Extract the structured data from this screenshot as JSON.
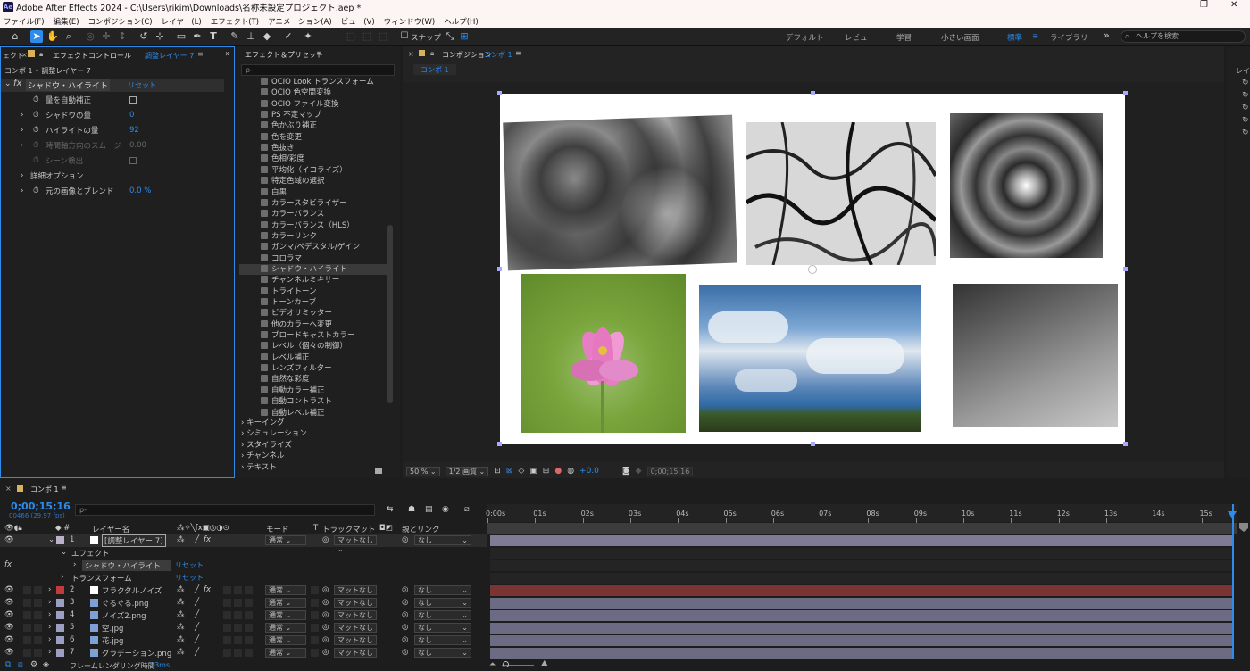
{
  "app": {
    "title": "Adobe After Effects 2024 - C:\\Users\\rikim\\Downloads\\名称未設定プロジェクト.aep *",
    "logo": "Ae",
    "window_buttons": [
      "─",
      "❐",
      "✕"
    ]
  },
  "menu": [
    "ファイル(F)",
    "編集(E)",
    "コンポジション(C)",
    "レイヤー(L)",
    "エフェクト(T)",
    "アニメーション(A)",
    "ビュー(V)",
    "ウィンドウ(W)",
    "ヘルプ(H)"
  ],
  "toolbar": {
    "snap_label": "スナップ",
    "workspaces": [
      "デフォルト",
      "レビュー",
      "学習",
      "小さい画面",
      "標準",
      "ライブラリ"
    ],
    "active_workspace": "標準",
    "more": "»",
    "help_placeholder": "ヘルプを検索"
  },
  "effect_controls": {
    "tab_prev": "ェクト",
    "tab_label": "エフェクトコントロール",
    "tab_layer": "調整レイヤー 7",
    "breadcrumb": "コンポ 1 • 調整レイヤー 7",
    "fx": "fx",
    "effect_name": "シャドウ・ハイライト",
    "reset": "リセット",
    "props": [
      {
        "label": "量を自動補正",
        "value": ""
      },
      {
        "label": "シャドウの量",
        "value": "0"
      },
      {
        "label": "ハイライトの量",
        "value": "92"
      },
      {
        "label": "時間軸方向のスムージ",
        "value": "0.00"
      },
      {
        "label": "シーン検出",
        "value": ""
      },
      {
        "label": "詳細オプション",
        "value": ""
      },
      {
        "label": "元の画像とブレンド",
        "value": "0.0 %"
      }
    ]
  },
  "effects_presets": {
    "tab_label": "エフェクト＆プリセット",
    "search_placeholder": "ρ-",
    "items": [
      "OCIO Look トランスフォーム",
      "OCIO 色空間変換",
      "OCIO ファイル変換",
      "PS 不定マップ",
      "色かぶり補正",
      "色を変更",
      "色抜き",
      "色相/彩度",
      "平均化（イコライズ）",
      "特定色域の選択",
      "白黒",
      "カラースタビライザー",
      "カラーバランス",
      "カラーバランス（HLS）",
      "カラーリンク",
      "ガンマ/ペデスタル/ゲイン",
      "コロラマ",
      "シャドウ・ハイライト",
      "チャンネルミキサー",
      "トライトーン",
      "トーンカーブ",
      "ビデオリミッター",
      "他のカラーへ変更",
      "ブロードキャストカラー",
      "レベル（個々の制御）",
      "レベル補正",
      "レンズフィルター",
      "自然な彩度",
      "自動カラー補正",
      "自動コントラスト",
      "自動レベル補正"
    ],
    "selected": "シャドウ・ハイライト",
    "categories": [
      "キーイング",
      "シミュレーション",
      "スタイライズ",
      "チャンネル",
      "テキスト"
    ]
  },
  "composition": {
    "tab_label": "コンポジション",
    "tab_comp": "コンポ 1",
    "sub_tab": "コンポ 1",
    "zoom": "50 %",
    "resolution": "1/2 画質",
    "exposure": "+0.0",
    "timecode": "0;00;15;16"
  },
  "timeline": {
    "tab_label": "コンポ 1",
    "timecode": "0;00;15;16",
    "frame_info": "00466 (29.97 fps)",
    "search_placeholder": "ρ-",
    "headers": {
      "layer_name": "レイヤー名",
      "mode": "モード",
      "t": "T",
      "track_matte": "トラックマット",
      "parent": "親とリンク"
    },
    "ruler": [
      "0:00s",
      "01s",
      "02s",
      "03s",
      "04s",
      "05s",
      "06s",
      "07s",
      "08s",
      "09s",
      "10s",
      "11s",
      "12s",
      "13s",
      "14s",
      "15s"
    ],
    "layers": [
      {
        "num": "1",
        "name": "[調整レイヤー 7]",
        "color": "#b9b2c8",
        "mode": "通常",
        "matte": "マットなし",
        "parent": "なし"
      },
      {
        "num": "2",
        "name": "フラクタルノイズ",
        "color": "#c03b3b",
        "mode": "通常",
        "matte": "マットなし",
        "parent": "なし"
      },
      {
        "num": "3",
        "name": "ぐるぐる.png",
        "color": "#9d9fc2",
        "mode": "通常",
        "matte": "マットなし",
        "parent": "なし"
      },
      {
        "num": "4",
        "name": "ノイズ2.png",
        "color": "#9d9fc2",
        "mode": "通常",
        "matte": "マットなし",
        "parent": "なし"
      },
      {
        "num": "5",
        "name": "空.jpg",
        "color": "#9d9fc2",
        "mode": "通常",
        "matte": "マットなし",
        "parent": "なし"
      },
      {
        "num": "6",
        "name": "花.jpg",
        "color": "#9d9fc2",
        "mode": "通常",
        "matte": "マットなし",
        "parent": "なし"
      },
      {
        "num": "7",
        "name": "グラデーション.png",
        "color": "#9d9fc2",
        "mode": "通常",
        "matte": "マットなし",
        "parent": "なし"
      }
    ],
    "sub_effect": "エフェクト",
    "sub_effect_name": "シャドウ・ハイライト",
    "sub_transform": "トランスフォーム",
    "reset": "リセット",
    "footer_label": "フレームレンダリング時間",
    "footer_value": "23ms"
  }
}
